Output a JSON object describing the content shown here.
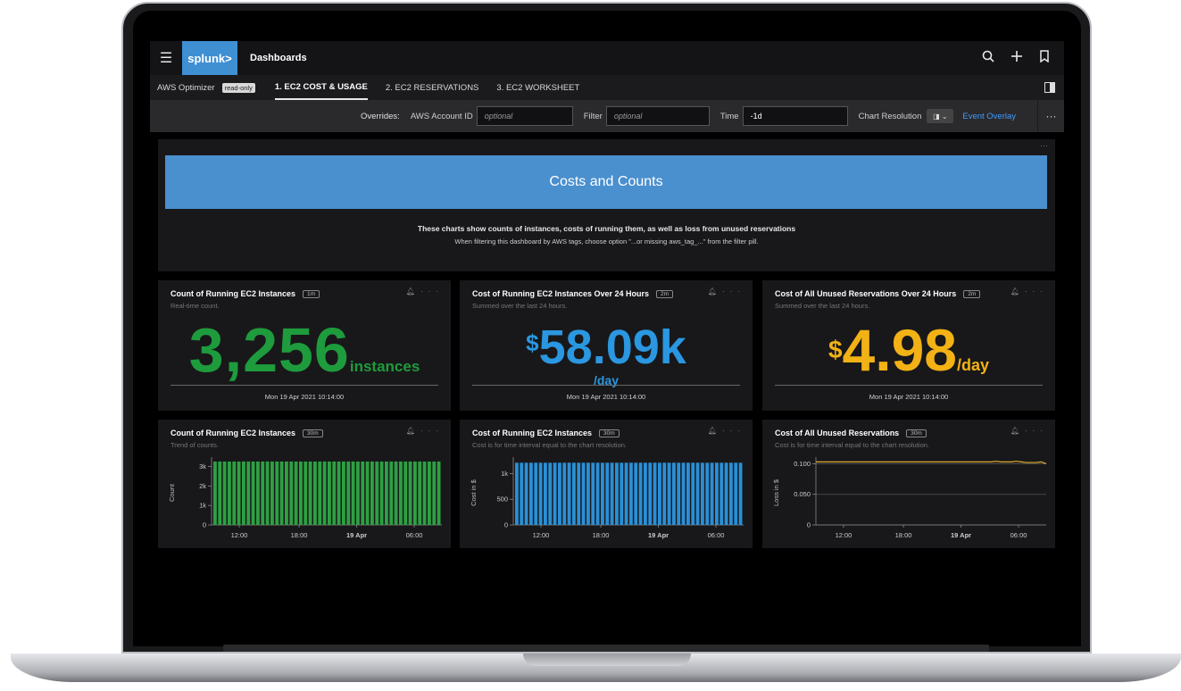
{
  "appbar": {
    "logo": "splunk>",
    "title": "Dashboards"
  },
  "tabrow": {
    "crumb": "AWS Optimizer",
    "badge": "read-only",
    "tabs": [
      "1. EC2 COST & USAGE",
      "2. EC2 RESERVATIONS",
      "3. EC2 WORKSHEET"
    ],
    "active_tab": "1. EC2 COST & USAGE"
  },
  "overrides": {
    "label": "Overrides:",
    "account_label": "AWS Account ID",
    "account_placeholder": "optional",
    "filter_label": "Filter",
    "filter_placeholder": "optional",
    "time_label": "Time",
    "time_value": "-1d",
    "resolution_label": "Chart Resolution",
    "event_overlay": "Event Overlay"
  },
  "text_panel": {
    "banner": "Costs and Counts",
    "line1": "These charts show counts of instances, costs of running them, as well as loss from unused reservations",
    "line2": "When filtering this dashboard by AWS tags, choose option \"...or missing aws_tag_...\" from the filter pill."
  },
  "single_values": [
    {
      "title": "Count of Running EC2 Instances",
      "resolution": "1m",
      "subtitle": "Real-time count.",
      "prefix": "",
      "value": "3,256",
      "suffix": "instances",
      "color": "#1e9b3c",
      "timestamp": "Mon 19 Apr 2021 10:14:00"
    },
    {
      "title": "Cost of Running EC2 Instances Over 24 Hours",
      "resolution": "2m",
      "subtitle": "Summed over the last 24 hours.",
      "prefix": "$",
      "value": "58.09k",
      "suffix": "/day",
      "color": "#2a97e0",
      "timestamp": "Mon 19 Apr 2021 10:14:00"
    },
    {
      "title": "Cost of All Unused Reservations Over 24 Hours",
      "resolution": "2m",
      "subtitle": "Summed over the last 24 hours.",
      "prefix": "$",
      "value": "4.98",
      "suffix": "/day",
      "color": "#f2b215",
      "timestamp": "Mon 19 Apr 2021 10:14:00"
    }
  ],
  "charts": [
    {
      "title": "Count of Running EC2 Instances",
      "resolution": "30m",
      "subtitle": "Trend of counts."
    },
    {
      "title": "Cost of Running EC2 Instances",
      "resolution": "30m",
      "subtitle": "Cost is for time interval equal to the chart resolution."
    },
    {
      "title": "Cost of All Unused Reservations",
      "resolution": "30m",
      "subtitle": "Cost is for time interval equal to the chart resolution."
    }
  ],
  "chart_data": [
    {
      "type": "bar",
      "ylabel": "Count",
      "yticks": [
        "0",
        "1k",
        "2k",
        "3k"
      ],
      "ylim": [
        0,
        3300
      ],
      "xticks": [
        "12:00",
        "18:00",
        "19 Apr",
        "06:00"
      ],
      "bar_count": 48,
      "values_constant": 3256,
      "color": "#2ea043"
    },
    {
      "type": "bar",
      "ylabel": "Cost in $",
      "yticks": [
        "0",
        "500",
        "1k"
      ],
      "ylim": [
        0,
        1250
      ],
      "xticks": [
        "12:00",
        "18:00",
        "19 Apr",
        "06:00"
      ],
      "bar_count": 48,
      "values_constant": 1210,
      "color": "#2a8fd6"
    },
    {
      "type": "line",
      "ylabel": "Loss in $",
      "yticks": [
        "0",
        "0.050",
        "0.100"
      ],
      "ylim": [
        0,
        0.105
      ],
      "xticks": [
        "12:00",
        "18:00",
        "19 Apr",
        "06:00"
      ],
      "values": [
        0.103,
        0.103,
        0.103,
        0.103,
        0.103,
        0.103,
        0.103,
        0.103,
        0.103,
        0.103,
        0.103,
        0.103,
        0.103,
        0.103,
        0.103,
        0.103,
        0.103,
        0.103,
        0.103,
        0.103,
        0.103,
        0.103,
        0.103,
        0.103,
        0.103,
        0.103,
        0.103,
        0.103,
        0.103,
        0.103,
        0.103,
        0.103,
        0.103,
        0.103,
        0.103,
        0.103,
        0.104,
        0.103,
        0.103,
        0.103,
        0.104,
        0.103,
        0.102,
        0.102,
        0.102,
        0.103,
        0.1
      ],
      "color": "#e0b030"
    }
  ]
}
